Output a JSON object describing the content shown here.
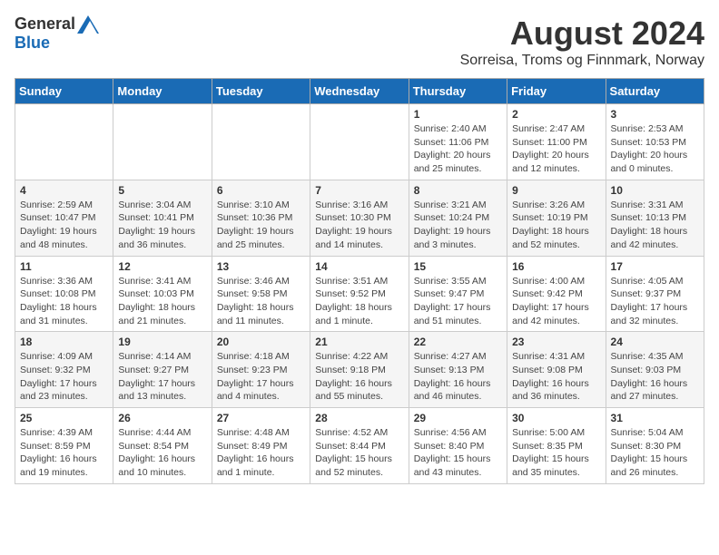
{
  "header": {
    "logo_general": "General",
    "logo_blue": "Blue",
    "month_title": "August 2024",
    "location": "Sorreisa, Troms og Finnmark, Norway"
  },
  "days_of_week": [
    "Sunday",
    "Monday",
    "Tuesday",
    "Wednesday",
    "Thursday",
    "Friday",
    "Saturday"
  ],
  "weeks": [
    {
      "days": [
        {
          "number": "",
          "info": ""
        },
        {
          "number": "",
          "info": ""
        },
        {
          "number": "",
          "info": ""
        },
        {
          "number": "",
          "info": ""
        },
        {
          "number": "1",
          "info": "Sunrise: 2:40 AM\nSunset: 11:06 PM\nDaylight: 20 hours\nand 25 minutes."
        },
        {
          "number": "2",
          "info": "Sunrise: 2:47 AM\nSunset: 11:00 PM\nDaylight: 20 hours\nand 12 minutes."
        },
        {
          "number": "3",
          "info": "Sunrise: 2:53 AM\nSunset: 10:53 PM\nDaylight: 20 hours\nand 0 minutes."
        }
      ]
    },
    {
      "days": [
        {
          "number": "4",
          "info": "Sunrise: 2:59 AM\nSunset: 10:47 PM\nDaylight: 19 hours\nand 48 minutes."
        },
        {
          "number": "5",
          "info": "Sunrise: 3:04 AM\nSunset: 10:41 PM\nDaylight: 19 hours\nand 36 minutes."
        },
        {
          "number": "6",
          "info": "Sunrise: 3:10 AM\nSunset: 10:36 PM\nDaylight: 19 hours\nand 25 minutes."
        },
        {
          "number": "7",
          "info": "Sunrise: 3:16 AM\nSunset: 10:30 PM\nDaylight: 19 hours\nand 14 minutes."
        },
        {
          "number": "8",
          "info": "Sunrise: 3:21 AM\nSunset: 10:24 PM\nDaylight: 19 hours\nand 3 minutes."
        },
        {
          "number": "9",
          "info": "Sunrise: 3:26 AM\nSunset: 10:19 PM\nDaylight: 18 hours\nand 52 minutes."
        },
        {
          "number": "10",
          "info": "Sunrise: 3:31 AM\nSunset: 10:13 PM\nDaylight: 18 hours\nand 42 minutes."
        }
      ]
    },
    {
      "days": [
        {
          "number": "11",
          "info": "Sunrise: 3:36 AM\nSunset: 10:08 PM\nDaylight: 18 hours\nand 31 minutes."
        },
        {
          "number": "12",
          "info": "Sunrise: 3:41 AM\nSunset: 10:03 PM\nDaylight: 18 hours\nand 21 minutes."
        },
        {
          "number": "13",
          "info": "Sunrise: 3:46 AM\nSunset: 9:58 PM\nDaylight: 18 hours\nand 11 minutes."
        },
        {
          "number": "14",
          "info": "Sunrise: 3:51 AM\nSunset: 9:52 PM\nDaylight: 18 hours\nand 1 minute."
        },
        {
          "number": "15",
          "info": "Sunrise: 3:55 AM\nSunset: 9:47 PM\nDaylight: 17 hours\nand 51 minutes."
        },
        {
          "number": "16",
          "info": "Sunrise: 4:00 AM\nSunset: 9:42 PM\nDaylight: 17 hours\nand 42 minutes."
        },
        {
          "number": "17",
          "info": "Sunrise: 4:05 AM\nSunset: 9:37 PM\nDaylight: 17 hours\nand 32 minutes."
        }
      ]
    },
    {
      "days": [
        {
          "number": "18",
          "info": "Sunrise: 4:09 AM\nSunset: 9:32 PM\nDaylight: 17 hours\nand 23 minutes."
        },
        {
          "number": "19",
          "info": "Sunrise: 4:14 AM\nSunset: 9:27 PM\nDaylight: 17 hours\nand 13 minutes."
        },
        {
          "number": "20",
          "info": "Sunrise: 4:18 AM\nSunset: 9:23 PM\nDaylight: 17 hours\nand 4 minutes."
        },
        {
          "number": "21",
          "info": "Sunrise: 4:22 AM\nSunset: 9:18 PM\nDaylight: 16 hours\nand 55 minutes."
        },
        {
          "number": "22",
          "info": "Sunrise: 4:27 AM\nSunset: 9:13 PM\nDaylight: 16 hours\nand 46 minutes."
        },
        {
          "number": "23",
          "info": "Sunrise: 4:31 AM\nSunset: 9:08 PM\nDaylight: 16 hours\nand 36 minutes."
        },
        {
          "number": "24",
          "info": "Sunrise: 4:35 AM\nSunset: 9:03 PM\nDaylight: 16 hours\nand 27 minutes."
        }
      ]
    },
    {
      "days": [
        {
          "number": "25",
          "info": "Sunrise: 4:39 AM\nSunset: 8:59 PM\nDaylight: 16 hours\nand 19 minutes."
        },
        {
          "number": "26",
          "info": "Sunrise: 4:44 AM\nSunset: 8:54 PM\nDaylight: 16 hours\nand 10 minutes."
        },
        {
          "number": "27",
          "info": "Sunrise: 4:48 AM\nSunset: 8:49 PM\nDaylight: 16 hours\nand 1 minute."
        },
        {
          "number": "28",
          "info": "Sunrise: 4:52 AM\nSunset: 8:44 PM\nDaylight: 15 hours\nand 52 minutes."
        },
        {
          "number": "29",
          "info": "Sunrise: 4:56 AM\nSunset: 8:40 PM\nDaylight: 15 hours\nand 43 minutes."
        },
        {
          "number": "30",
          "info": "Sunrise: 5:00 AM\nSunset: 8:35 PM\nDaylight: 15 hours\nand 35 minutes."
        },
        {
          "number": "31",
          "info": "Sunrise: 5:04 AM\nSunset: 8:30 PM\nDaylight: 15 hours\nand 26 minutes."
        }
      ]
    }
  ]
}
